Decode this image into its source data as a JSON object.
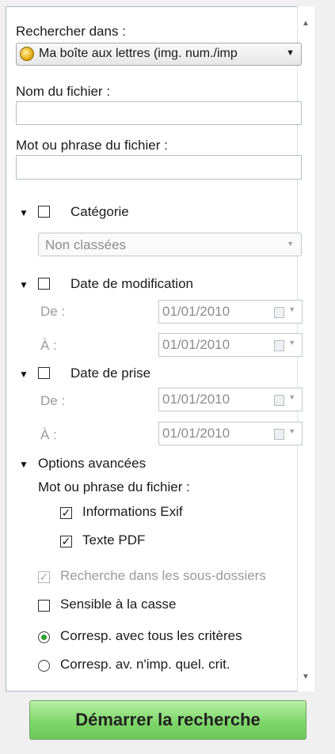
{
  "search_in": {
    "label": "Rechercher dans :",
    "value": "Ma boîte aux lettres (img. num./imp"
  },
  "filename": {
    "label": "Nom du fichier :",
    "value": ""
  },
  "phrase": {
    "label": "Mot ou phrase du fichier :",
    "value": ""
  },
  "category": {
    "label": "Catégorie",
    "checked": false,
    "select_value": "Non classées"
  },
  "modified": {
    "label": "Date de modification",
    "checked": false,
    "from_label": "De :",
    "to_label": "À :",
    "from": "01/01/2010",
    "to": "01/01/2010"
  },
  "taken": {
    "label": "Date de prise",
    "checked": false,
    "from_label": "De :",
    "to_label": "À :",
    "from": "01/01/2010",
    "to": "01/01/2010"
  },
  "advanced": {
    "label": "Options avancées",
    "phrase_label": "Mot ou phrase du fichier :",
    "exif_label": "Informations Exif",
    "exif_checked": true,
    "pdf_label": "Texte PDF",
    "pdf_checked": true,
    "subfolders_label": "Recherche dans les sous-dossiers",
    "subfolders_checked": true,
    "case_label": "Sensible à la casse",
    "case_checked": false,
    "match_all_label": "Corresp. avec tous les critères",
    "match_any_label": "Corresp. av. n'imp. quel. crit.",
    "selected_match": "all"
  },
  "start_button": "Démarrer la recherche",
  "colors": {
    "accent_green": "#7fd66a",
    "radio_dot": "#2f9e2f"
  }
}
